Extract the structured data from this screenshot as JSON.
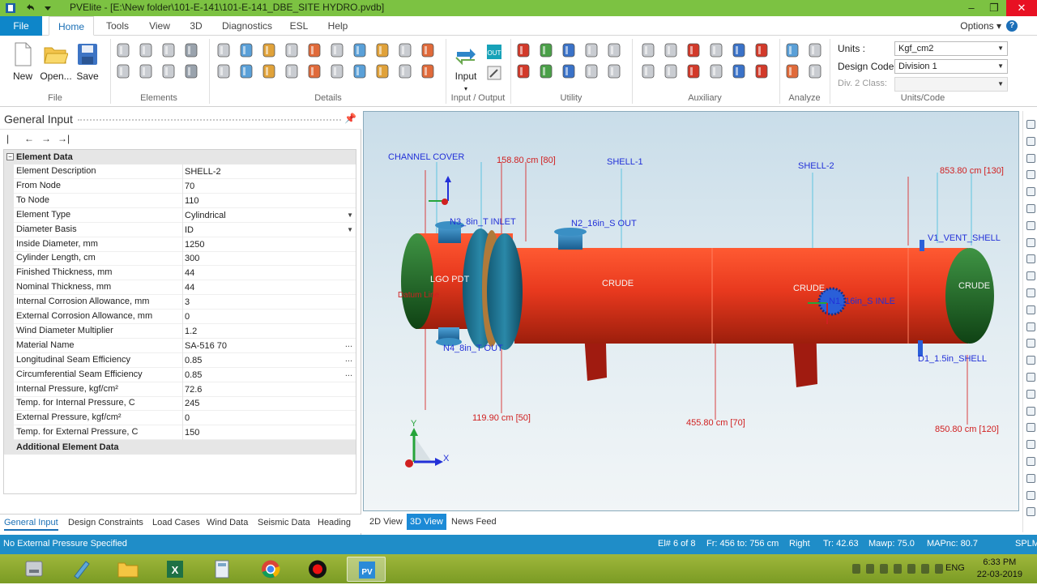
{
  "window": {
    "title": "PVElite - [E:\\New folder\\101-E-141\\101-E-141_DBE_SITE HYDRO.pvdb]",
    "controls": [
      "–",
      "❐",
      "✕"
    ]
  },
  "ribbon": {
    "file_tab": "File",
    "tabs": [
      "Home",
      "Tools",
      "View",
      "3D",
      "Diagnostics",
      "ESL",
      "Help"
    ],
    "active_tab": "Home",
    "options_label": "Options",
    "help_glyph": "?",
    "file_group": {
      "new": "New",
      "open": "Open...",
      "save": "Save",
      "label": "File"
    },
    "elements_group": {
      "label": "Elements"
    },
    "details_group": {
      "label": "Details"
    },
    "io_group": {
      "input": "Input",
      "label": "Input / Output"
    },
    "utility_group": {
      "label": "Utility"
    },
    "auxiliary_group": {
      "label": "Auxiliary"
    },
    "analyze_group": {
      "label": "Analyze"
    },
    "units_group": {
      "label": "Units/Code",
      "units_label": "Units :",
      "units_value": "Kgf_cm2",
      "design_code_label": "Design Code :",
      "design_code_value": "Division 1",
      "div2_label": "Div. 2 Class:",
      "div2_value": ""
    }
  },
  "left_panel": {
    "title": "General Input",
    "pin_glyph": "📌",
    "nav": [
      "|←",
      "←",
      "→",
      "→|"
    ],
    "categories": {
      "element_data": "Element Data",
      "additional": "Additional Element Data"
    },
    "properties": [
      {
        "name": "Element Description",
        "value": "SHELL-2"
      },
      {
        "name": "From Node",
        "value": "70"
      },
      {
        "name": "To Node",
        "value": "110"
      },
      {
        "name": "Element Type",
        "value": "Cylindrical"
      },
      {
        "name": "Diameter Basis",
        "value": "ID"
      },
      {
        "name": "Inside Diameter, mm",
        "value": "1250"
      },
      {
        "name": "Cylinder Length, cm",
        "value": "300"
      },
      {
        "name": "Finished Thickness, mm",
        "value": "44"
      },
      {
        "name": "Nominal Thickness, mm",
        "value": "44"
      },
      {
        "name": "Internal Corrosion Allowance, mm",
        "value": "3"
      },
      {
        "name": "External Corrosion Allowance, mm",
        "value": "0"
      },
      {
        "name": "Wind Diameter Multiplier",
        "value": "1.2"
      },
      {
        "name": "Material Name",
        "value": "SA-516 70"
      },
      {
        "name": "Longitudinal Seam Efficiency",
        "value": "0.85"
      },
      {
        "name": "Circumferential Seam Efficiency",
        "value": "0.85"
      },
      {
        "name": "Internal Pressure, kgf/cm²",
        "value": "72.6"
      },
      {
        "name": "Temp. for Internal Pressure, C",
        "value": "245"
      },
      {
        "name": "External Pressure, kgf/cm²",
        "value": "0"
      },
      {
        "name": "Temp. for External Pressure, C",
        "value": "150"
      }
    ],
    "ellipsis_glyph": "...",
    "bottom_tabs": [
      "General Input",
      "Design Constraints",
      "Load Cases",
      "Wind Data",
      "Seismic Data",
      "Heading"
    ]
  },
  "viewport": {
    "labels": {
      "channel_cover": "CHANNEL COVER",
      "dim_top_1": "158.80 cm   [80]",
      "shell1": "SHELL-1",
      "shell2": "SHELL-2",
      "dim_top_2": "853.80 cm   [130]",
      "n3": "N3_8in_T INLET",
      "n2": "N2_16in_S OUT",
      "v1": "V1_VENT_SHELL",
      "lgo": "LGO PDT",
      "datum": "Datum Line",
      "crude1": "CRUDE",
      "crude2": "CRUDE",
      "crude3": "CRUDE",
      "n1": "N1_16in_S INLE",
      "n4": "N4_8in_T OUT",
      "d1": "D1_1.5in_SHELL",
      "dim_bot_1": "119.90 cm   [50]",
      "dim_bot_2": "455.80 cm   [70]",
      "dim_bot_3": "850.80 cm   [120]",
      "axis_x": "X",
      "axis_y": "Y"
    },
    "tabs": [
      "2D View",
      "3D View",
      "News Feed"
    ],
    "active_tab": "3D View"
  },
  "status": {
    "message": "No External Pressure Specified",
    "element": "El# 6 of 8",
    "from_to": "Fr: 456 to: 756 cm",
    "view": "Right",
    "tr": "Tr: 42.63",
    "mawp": "Mawp: 75.0",
    "mapnc": "MAPnc: 80.7",
    "spl": "SPLM"
  },
  "taskbar": {
    "lang": "ENG",
    "time": "6:33 PM",
    "date": "22-03-2019"
  },
  "colors": {
    "title_bar": "#7cc242",
    "accent": "#1c8ad6",
    "vessel": "#e8391e",
    "head": "#1f6b24",
    "flange": "#1d6f8f"
  }
}
